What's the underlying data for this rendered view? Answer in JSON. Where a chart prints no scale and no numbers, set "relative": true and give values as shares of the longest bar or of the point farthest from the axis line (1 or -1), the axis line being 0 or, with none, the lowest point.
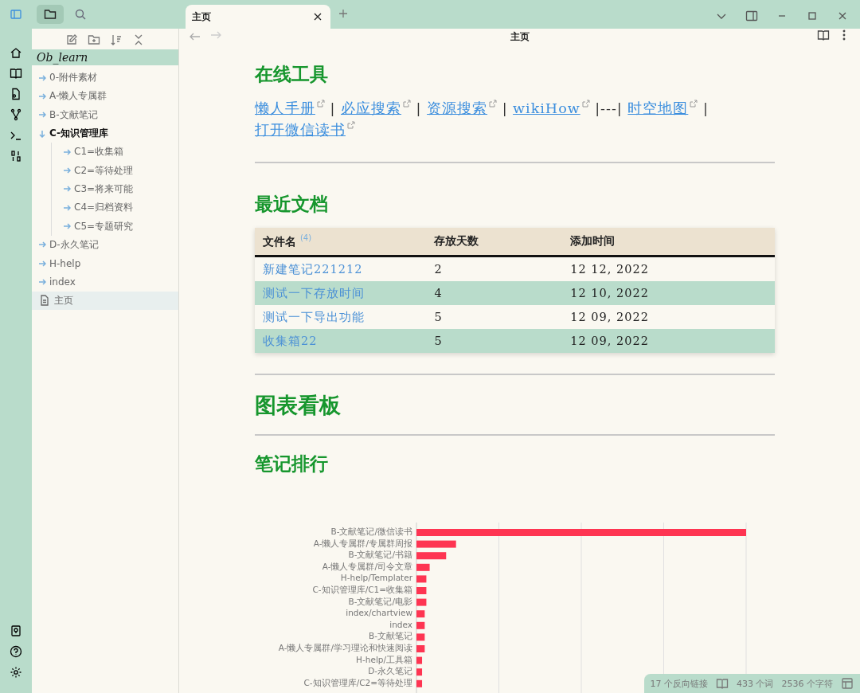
{
  "tabs": [
    {
      "label": "主页",
      "selected": true
    }
  ],
  "header": {
    "title": "主页"
  },
  "sidebar": {
    "vault": "Ob_learn",
    "items": [
      {
        "label": "0-附件素材",
        "kind": "folder",
        "expanded": false,
        "selected": false
      },
      {
        "label": "A-懒人专属群",
        "kind": "folder",
        "expanded": false,
        "selected": false
      },
      {
        "label": "B-文献笔记",
        "kind": "folder",
        "expanded": false,
        "selected": false
      },
      {
        "label": "C-知识管理库",
        "kind": "folder",
        "expanded": true,
        "selected": false,
        "children": [
          {
            "label": "C1=收集箱",
            "kind": "folder",
            "expanded": false,
            "selected": false
          },
          {
            "label": "C2=等待处理",
            "kind": "folder",
            "expanded": false,
            "selected": false
          },
          {
            "label": "C3=将来可能",
            "kind": "folder",
            "expanded": false,
            "selected": false
          },
          {
            "label": "C4=归档资料",
            "kind": "folder",
            "expanded": false,
            "selected": false
          },
          {
            "label": "C5=专题研究",
            "kind": "folder",
            "expanded": false,
            "selected": false
          }
        ]
      },
      {
        "label": "D-永久笔记",
        "kind": "folder",
        "expanded": false,
        "selected": false
      },
      {
        "label": "H-help",
        "kind": "folder",
        "expanded": false,
        "selected": false
      },
      {
        "label": "index",
        "kind": "folder",
        "expanded": false,
        "selected": false
      },
      {
        "label": "主页",
        "kind": "file",
        "selected": true
      }
    ]
  },
  "tools": {
    "heading": "在线工具",
    "parts": [
      {
        "kind": "link",
        "text": "懒人手册"
      },
      {
        "kind": "text",
        "text": " | "
      },
      {
        "kind": "link",
        "text": "必应搜索"
      },
      {
        "kind": "text",
        "text": " | "
      },
      {
        "kind": "link",
        "text": "资源搜索"
      },
      {
        "kind": "text",
        "text": " | "
      },
      {
        "kind": "link",
        "text": "wikiHow"
      },
      {
        "kind": "text",
        "text": " |---| "
      },
      {
        "kind": "link",
        "text": "时空地图"
      },
      {
        "kind": "text",
        "text": " | "
      },
      {
        "kind": "link",
        "text": "打开微信读书"
      }
    ]
  },
  "recent": {
    "heading": "最近文档",
    "columns": [
      {
        "label": "文件名",
        "count": "(4)"
      },
      {
        "label": "存放天数"
      },
      {
        "label": "添加时间"
      }
    ],
    "rows": [
      {
        "name": "新建笔记221212",
        "days": "2",
        "added": "12 12, 2022"
      },
      {
        "name": "测试一下存放时间",
        "days": "4",
        "added": "12 10, 2022"
      },
      {
        "name": "测试一下导出功能",
        "days": "5",
        "added": "12 09, 2022"
      },
      {
        "name": "收集箱22",
        "days": "5",
        "added": "12 09, 2022"
      }
    ]
  },
  "board": {
    "heading": "图表看板"
  },
  "ranking": {
    "heading": "笔记排行",
    "chart_data": {
      "type": "bar",
      "orientation": "horizontal",
      "relative": true,
      "categories": [
        "B-文献笔记/微信读书",
        "A-懒人专属群/专属群周报",
        "B-文献笔记/书籍",
        "A-懒人专属群/司令文章",
        "H-help/Templater",
        "C-知识管理库/C1=收集箱",
        "B-文献笔记/电影",
        "index/chartview",
        "index",
        "B-文献笔记",
        "A-懒人专属群/学习理论和快速阅读",
        "H-help/工具箱",
        "D-永久笔记",
        "C-知识管理库/C2=等待处理"
      ],
      "series": [
        {
          "color": "#fe3552",
          "values": [
            1,
            0.12,
            0.09,
            0.04,
            0.03,
            0.03,
            0.03,
            0.025,
            0.025,
            0.025,
            0.025,
            0.017,
            0.017,
            0.017
          ]
        }
      ]
    }
  },
  "status_bar": {
    "backlinks": "17 个反向链接",
    "words": "433 个词",
    "chars": "2536 个字符"
  }
}
